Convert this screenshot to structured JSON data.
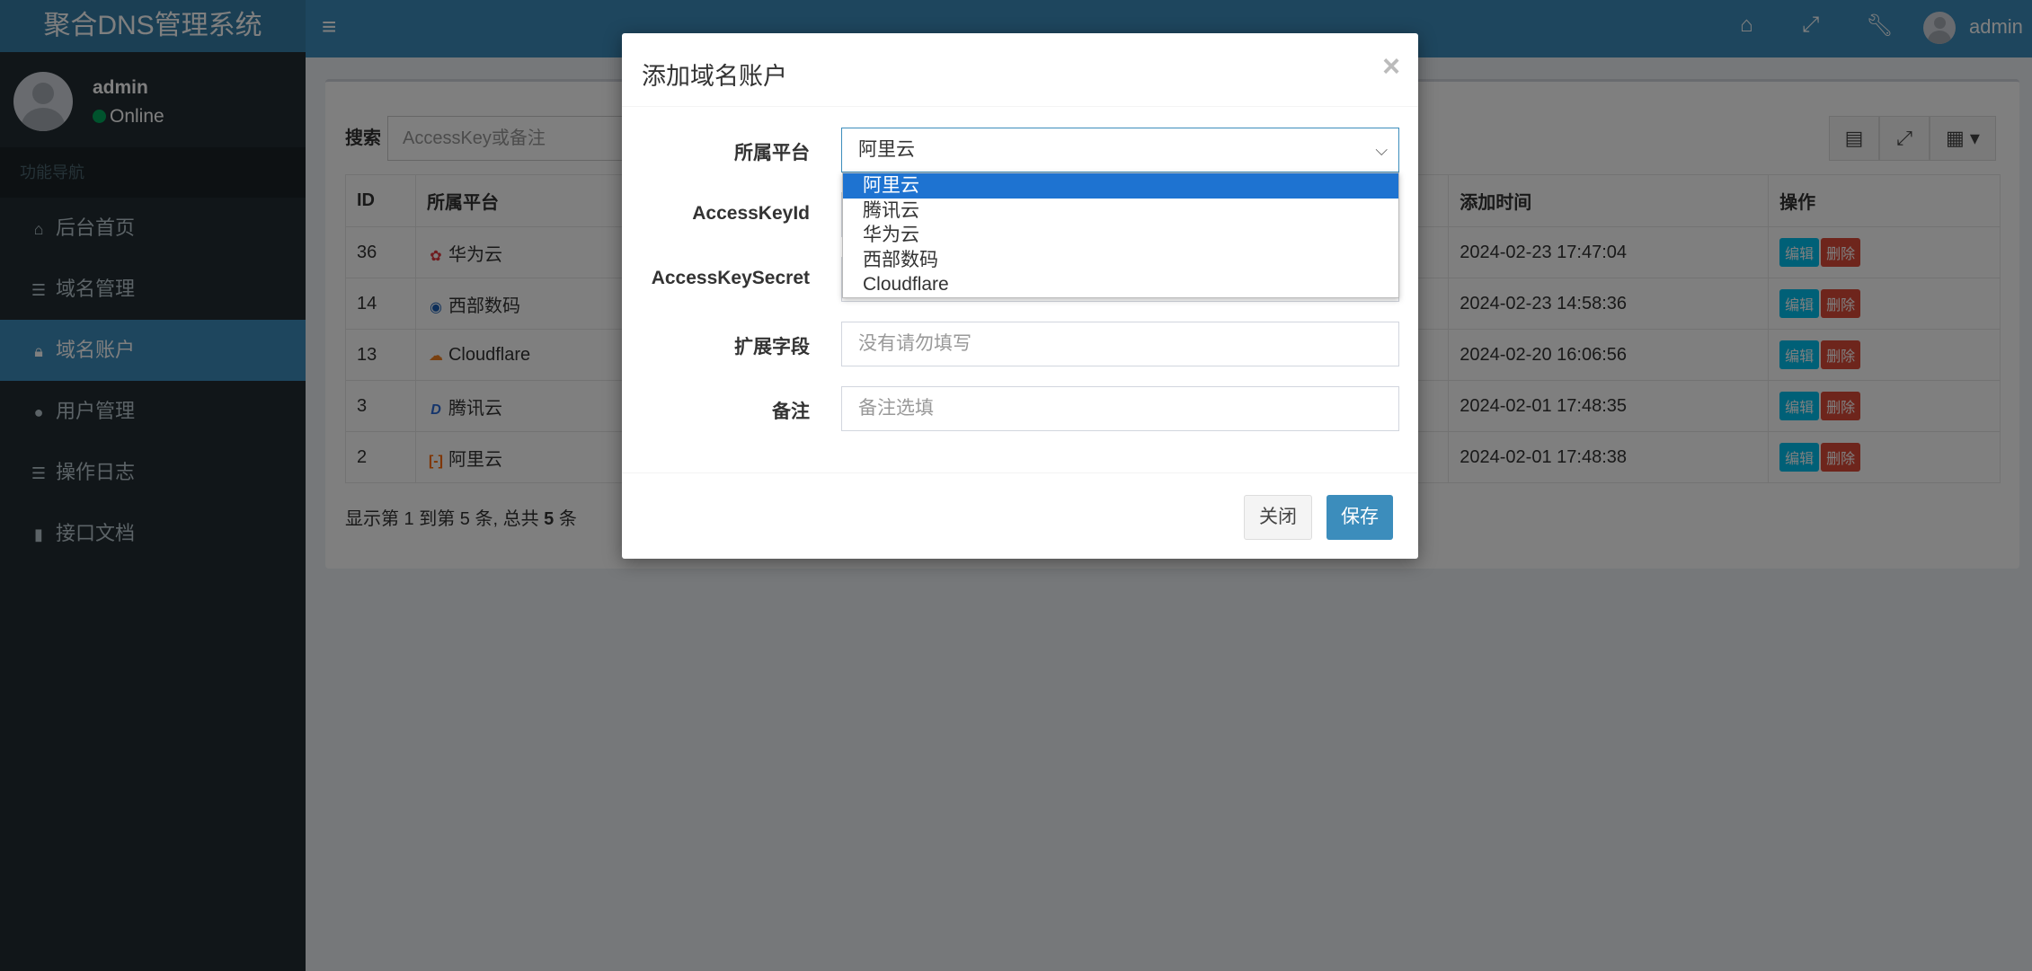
{
  "app": {
    "brand": "聚合DNS管理系统"
  },
  "user_panel": {
    "name": "admin",
    "status": "Online"
  },
  "sidebar": {
    "header": "功能导航",
    "items": [
      {
        "label": "后台首页",
        "icon": "home-icon"
      },
      {
        "label": "域名管理",
        "icon": "list-icon"
      },
      {
        "label": "域名账户",
        "icon": "lock-icon",
        "active": true
      },
      {
        "label": "用户管理",
        "icon": "user-icon"
      },
      {
        "label": "操作日志",
        "icon": "list-icon"
      },
      {
        "label": "接口文档",
        "icon": "book-icon"
      }
    ]
  },
  "topbar": {
    "username": "admin",
    "icons": [
      "menu-icon",
      "home-icon",
      "fullscreen-icon",
      "wrench-icon"
    ]
  },
  "toolbar": {
    "search_label": "搜索",
    "search_placeholder": "AccessKey或备注"
  },
  "table": {
    "columns": [
      "ID",
      "所属平台",
      "添加时间",
      "操作"
    ],
    "rows": [
      {
        "id": "36",
        "platform": "华为云",
        "time": "2024-02-23 17:47:04"
      },
      {
        "id": "14",
        "platform": "西部数码",
        "time": "2024-02-23 14:58:36"
      },
      {
        "id": "13",
        "platform": "Cloudflare",
        "time": "2024-02-20 16:06:56"
      },
      {
        "id": "3",
        "platform": "腾讯云",
        "time": "2024-02-01 17:48:35"
      },
      {
        "id": "2",
        "platform": "阿里云",
        "time": "2024-02-01 17:48:38"
      }
    ],
    "edit_label": "编辑",
    "delete_label": "删除"
  },
  "pagination": {
    "prefix": "显示第 1 到第 5 条, 总共 ",
    "total": "5",
    "suffix": " 条"
  },
  "modal": {
    "title": "添加域名账户",
    "close_symbol": "×",
    "fields": {
      "platform_label": "所属平台",
      "platform_value": "阿里云",
      "accesskeyid_label": "AccessKeyId",
      "accesskeysecret_label": "AccessKeySecret",
      "ext_label": "扩展字段",
      "ext_placeholder": "没有请勿填写",
      "remark_label": "备注",
      "remark_placeholder": "备注选填"
    },
    "platform_options": [
      "阿里云",
      "腾讯云",
      "华为云",
      "西部数码",
      "Cloudflare"
    ],
    "close_button": "关闭",
    "save_button": "保存"
  }
}
